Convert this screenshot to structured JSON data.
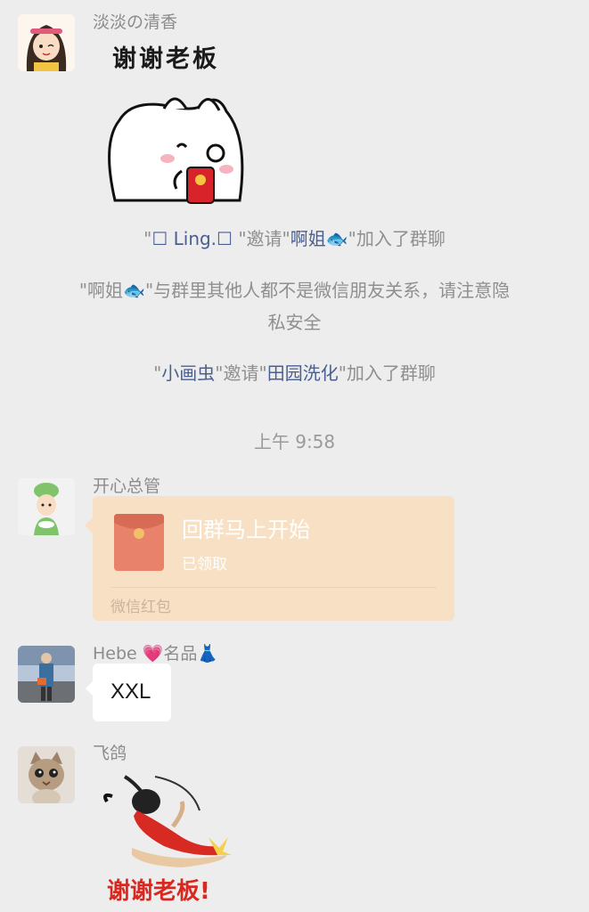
{
  "messages": {
    "m1": {
      "sender": "淡淡の清香",
      "sticker_text": "谢谢老板"
    },
    "system": [
      {
        "q1": "\"",
        "name1": "☐ Ling.☐",
        "q2": " \"邀请\"",
        "name2": "啊姐",
        "emoji": "🐟",
        "q3": "\"加入了群聊"
      },
      {
        "line1": "\"啊姐🐟\"与群里其他人都不是微信朋友关系，请注意隐",
        "line2": "私安全"
      },
      {
        "q1": "\"",
        "name1": "小画虫",
        "q2": "\"邀请\"",
        "name2": "田园洗化",
        "q3": "\"加入了群聊"
      }
    ],
    "timestamp": "上午 9:58",
    "m2": {
      "sender": "开心总管",
      "redpacket": {
        "title": "回群马上开始",
        "status": "已领取",
        "footer": "微信红包"
      }
    },
    "m3": {
      "sender": "Hebe 💗名品👗",
      "text": "XXL"
    },
    "m4": {
      "sender": "飞鸽",
      "sticker_text": "谢谢老板!"
    }
  },
  "colors": {
    "background": "#ededed",
    "redpacket_bg": "#f8e0c4",
    "redpacket_icon": "#e8826b",
    "link_name": "#4a5f90",
    "sticker_red": "#d9281f"
  }
}
